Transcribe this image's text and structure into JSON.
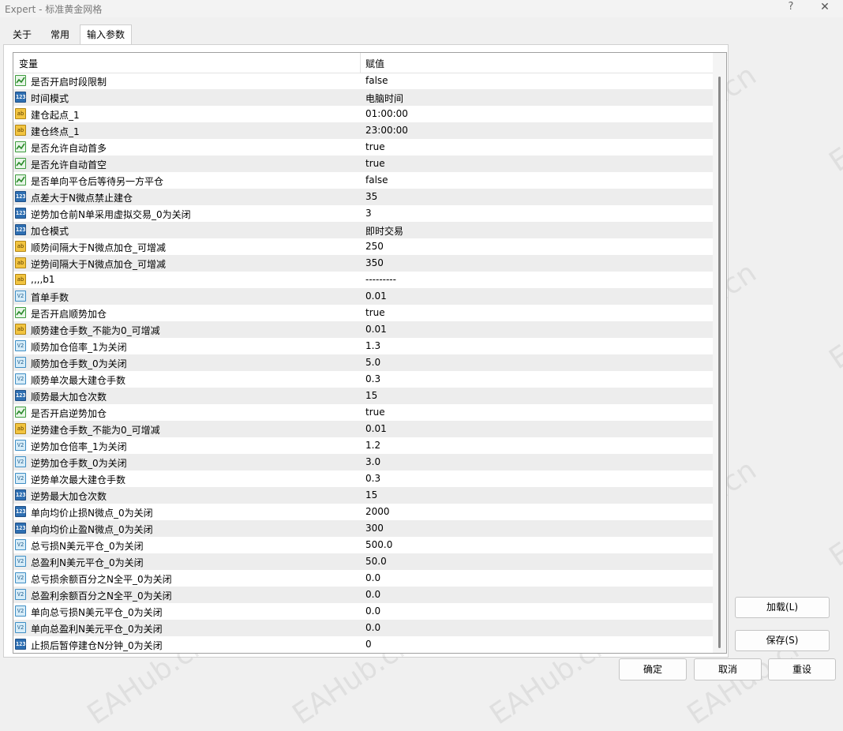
{
  "window": {
    "title": "Expert - 标准黄金网格",
    "help": "?",
    "close": "✕"
  },
  "tabs": [
    {
      "label": "关于"
    },
    {
      "label": "常用"
    },
    {
      "label": "输入参数"
    }
  ],
  "grid": {
    "headers": {
      "variable": "变量",
      "value": "赋值"
    },
    "rows": [
      {
        "type": "bool",
        "name": "是否开启时段限制",
        "value": "false"
      },
      {
        "type": "int",
        "name": "时间模式",
        "value": "电脑时间"
      },
      {
        "type": "str",
        "name": "建仓起点_1",
        "value": "01:00:00"
      },
      {
        "type": "str",
        "name": "建仓终点_1",
        "value": "23:00:00"
      },
      {
        "type": "bool",
        "name": "是否允许自动首多",
        "value": "true"
      },
      {
        "type": "bool",
        "name": "是否允许自动首空",
        "value": "true"
      },
      {
        "type": "bool",
        "name": "是否单向平仓后等待另一方平仓",
        "value": "false"
      },
      {
        "type": "int",
        "name": "点差大于N微点禁止建仓",
        "value": "35"
      },
      {
        "type": "int",
        "name": "逆势加仓前N单采用虚拟交易_0为关闭",
        "value": "3"
      },
      {
        "type": "int",
        "name": "加仓模式",
        "value": "即时交易"
      },
      {
        "type": "str",
        "name": "顺势间隔大于N微点加仓_可增减",
        "value": "250"
      },
      {
        "type": "str",
        "name": "逆势间隔大于N微点加仓_可增减",
        "value": "350"
      },
      {
        "type": "str",
        "name": ",,,,b1",
        "value": "---------"
      },
      {
        "type": "dbl",
        "name": "首单手数",
        "value": "0.01"
      },
      {
        "type": "bool",
        "name": "是否开启顺势加仓",
        "value": "true"
      },
      {
        "type": "str",
        "name": "顺势建仓手数_不能为0_可增减",
        "value": "0.01"
      },
      {
        "type": "dbl",
        "name": "顺势加仓倍率_1为关闭",
        "value": "1.3"
      },
      {
        "type": "dbl",
        "name": "顺势加仓手数_0为关闭",
        "value": "5.0"
      },
      {
        "type": "dbl",
        "name": "顺势单次最大建仓手数",
        "value": "0.3"
      },
      {
        "type": "int",
        "name": "顺势最大加仓次数",
        "value": "15"
      },
      {
        "type": "bool",
        "name": "是否开启逆势加仓",
        "value": "true"
      },
      {
        "type": "str",
        "name": "逆势建仓手数_不能为0_可增减",
        "value": "0.01"
      },
      {
        "type": "dbl",
        "name": "逆势加仓倍率_1为关闭",
        "value": "1.2"
      },
      {
        "type": "dbl",
        "name": "逆势加仓手数_0为关闭",
        "value": "3.0"
      },
      {
        "type": "dbl",
        "name": "逆势单次最大建仓手数",
        "value": "0.3"
      },
      {
        "type": "int",
        "name": "逆势最大加仓次数",
        "value": "15"
      },
      {
        "type": "int",
        "name": "单向均价止损N微点_0为关闭",
        "value": "2000"
      },
      {
        "type": "int",
        "name": "单向均价止盈N微点_0为关闭",
        "value": "300"
      },
      {
        "type": "dbl",
        "name": "总亏损N美元平仓_0为关闭",
        "value": "500.0"
      },
      {
        "type": "dbl",
        "name": "总盈利N美元平仓_0为关闭",
        "value": "50.0"
      },
      {
        "type": "dbl",
        "name": "总亏损余额百分之N全平_0为关闭",
        "value": "0.0"
      },
      {
        "type": "dbl",
        "name": "总盈利余额百分之N全平_0为关闭",
        "value": "0.0"
      },
      {
        "type": "dbl",
        "name": "单向总亏损N美元平仓_0为关闭",
        "value": "0.0"
      },
      {
        "type": "dbl",
        "name": "单向总盈利N美元平仓_0为关闭",
        "value": "0.0"
      },
      {
        "type": "int",
        "name": "止损后暂停建仓N分钟_0为关闭",
        "value": "0"
      }
    ]
  },
  "icon_labels": {
    "int": "123",
    "str": "ab",
    "dbl": "V2"
  },
  "watermark": "EAHub.cn",
  "buttons": {
    "load": "加载(L)",
    "save": "保存(S)",
    "ok": "确定",
    "cancel": "取消",
    "reset": "重设"
  },
  "colors": {
    "row_alt": "#ededed",
    "bool_icon": "#3e9b3e",
    "int_icon": "#2e6fb2",
    "str_icon": "#f2c440",
    "dbl_icon": "#3f8ec4"
  }
}
